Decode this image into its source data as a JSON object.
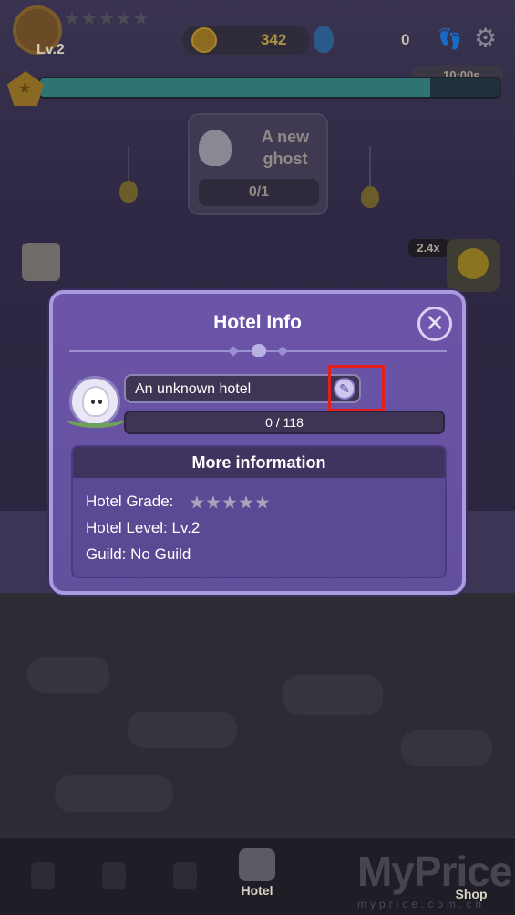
{
  "hud": {
    "level": "Lv.2",
    "coins": "342",
    "gems": "0",
    "timer": "10:00s",
    "xp_fraction": 0.85
  },
  "objective": {
    "title": "A new ghost",
    "progress": "0/1"
  },
  "speed": {
    "multiplier": "2.4x"
  },
  "modal": {
    "title": "Hotel Info",
    "close_icon": "close-icon",
    "hotel_name": "An unknown hotel",
    "edit_icon": "pencil-icon",
    "xp_text": "0 / 118",
    "xp_fraction": 0.0,
    "more_info": {
      "header": "More information",
      "grade_label": "Hotel Grade:",
      "grade_stars": 0,
      "grade_max": 5,
      "level_label": "Hotel Level:",
      "level_value": "Lv.2",
      "guild_label": "Guild:",
      "guild_value": "No Guild"
    }
  },
  "tabs": {
    "hotel": "Hotel",
    "shop": "Shop"
  },
  "watermark": {
    "brand": "MyPrice",
    "url": "myprice.com.cn"
  },
  "colors": {
    "modal_bg": "#6c54a8",
    "modal_border": "#a89be0",
    "highlight": "#e41d1d",
    "xp_bar": "#2f7472"
  }
}
